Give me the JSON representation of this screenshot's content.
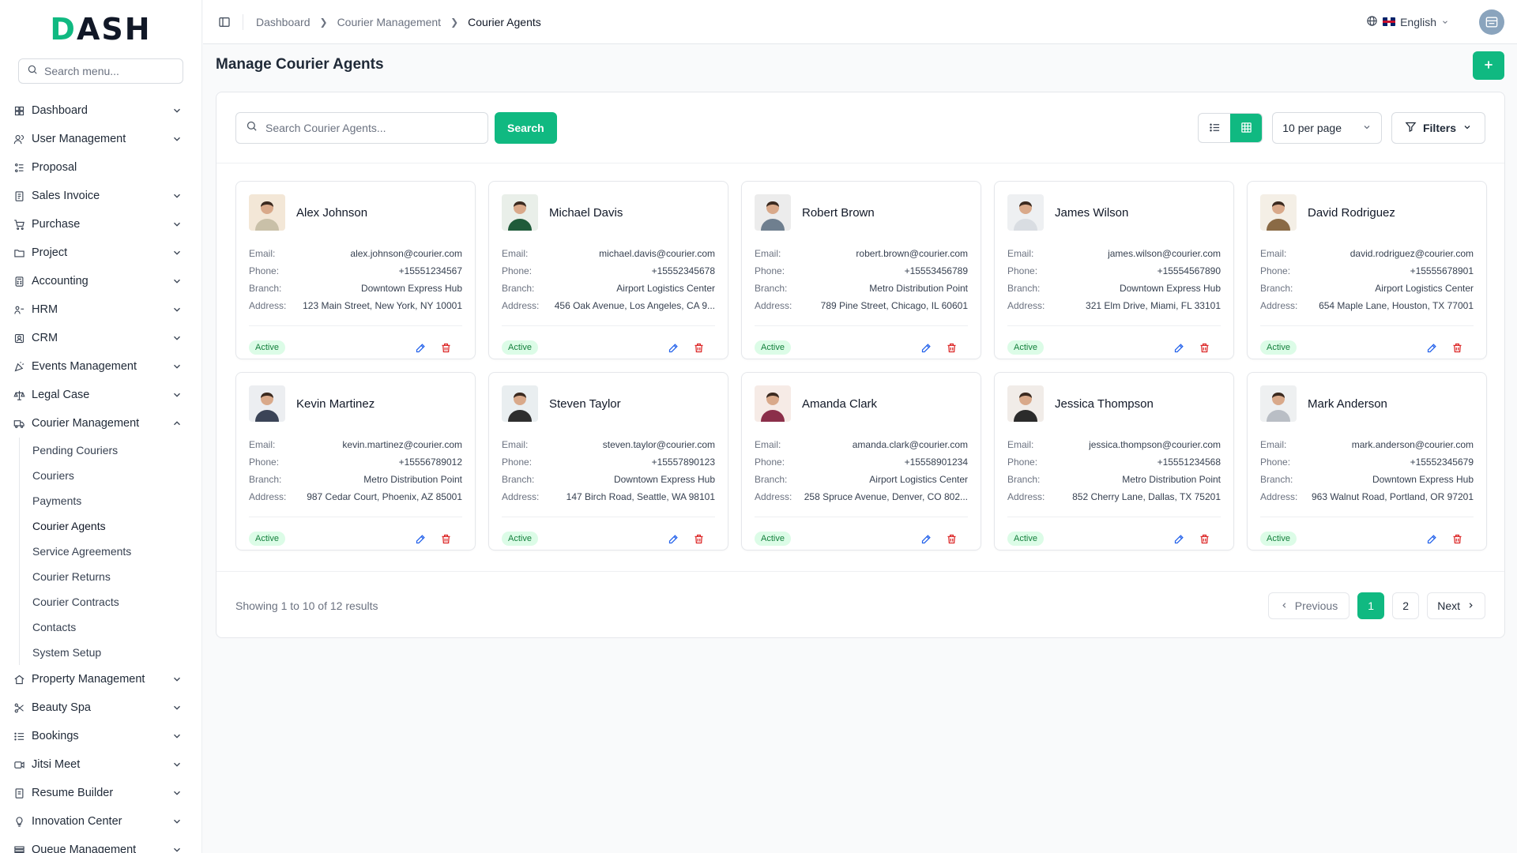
{
  "brand": {
    "logo_prefix": "D",
    "logo_rest": "ASH"
  },
  "sidebar": {
    "search_placeholder": "Search menu...",
    "items": [
      {
        "label": "Dashboard",
        "icon": "grid-icon",
        "chevron": "down"
      },
      {
        "label": "User Management",
        "icon": "users-icon",
        "chevron": "down"
      },
      {
        "label": "Proposal",
        "icon": "proposal-icon",
        "chevron": ""
      },
      {
        "label": "Sales Invoice",
        "icon": "invoice-icon",
        "chevron": "down"
      },
      {
        "label": "Purchase",
        "icon": "cart-icon",
        "chevron": "down"
      },
      {
        "label": "Project",
        "icon": "folder-icon",
        "chevron": "down"
      },
      {
        "label": "Accounting",
        "icon": "calculator-icon",
        "chevron": "down"
      },
      {
        "label": "HRM",
        "icon": "hrm-icon",
        "chevron": "down"
      },
      {
        "label": "CRM",
        "icon": "crm-icon",
        "chevron": "down"
      },
      {
        "label": "Events Management",
        "icon": "party-icon",
        "chevron": "down"
      },
      {
        "label": "Legal Case",
        "icon": "scale-icon",
        "chevron": "down"
      },
      {
        "label": "Courier Management",
        "icon": "truck-icon",
        "chevron": "up"
      }
    ],
    "sub_items": [
      "Pending Couriers",
      "Couriers",
      "Payments",
      "Courier Agents",
      "Service Agreements",
      "Courier Returns",
      "Courier Contracts",
      "Contacts",
      "System Setup"
    ],
    "items_after": [
      {
        "label": "Property Management",
        "icon": "property-icon"
      },
      {
        "label": "Beauty Spa",
        "icon": "scissors-icon"
      },
      {
        "label": "Bookings",
        "icon": "list-icon"
      },
      {
        "label": "Jitsi Meet",
        "icon": "video-icon"
      },
      {
        "label": "Resume Builder",
        "icon": "resume-icon"
      },
      {
        "label": "Innovation Center",
        "icon": "bulb-icon"
      },
      {
        "label": "Queue Management",
        "icon": "queue-icon"
      }
    ]
  },
  "topbar": {
    "breadcrumb": [
      "Dashboard",
      "Courier Management",
      "Courier Agents"
    ],
    "language": "English"
  },
  "page": {
    "title": "Manage Courier Agents",
    "search_placeholder": "Search Courier Agents...",
    "search_button": "Search",
    "per_page": "10 per page",
    "filters_label": "Filters"
  },
  "labels": {
    "email": "Email:",
    "phone": "Phone:",
    "branch": "Branch:",
    "address": "Address:"
  },
  "agents": [
    {
      "name": "Alex Johnson",
      "email": "alex.johnson@courier.com",
      "phone": "+15551234567",
      "branch": "Downtown Express Hub",
      "address": "123 Main Street, New York, NY 10001",
      "status": "Active"
    },
    {
      "name": "Michael Davis",
      "email": "michael.davis@courier.com",
      "phone": "+15552345678",
      "branch": "Airport Logistics Center",
      "address": "456 Oak Avenue, Los Angeles, CA 9...",
      "status": "Active"
    },
    {
      "name": "Robert Brown",
      "email": "robert.brown@courier.com",
      "phone": "+15553456789",
      "branch": "Metro Distribution Point",
      "address": "789 Pine Street, Chicago, IL 60601",
      "status": "Active"
    },
    {
      "name": "James Wilson",
      "email": "james.wilson@courier.com",
      "phone": "+15554567890",
      "branch": "Downtown Express Hub",
      "address": "321 Elm Drive, Miami, FL 33101",
      "status": "Active"
    },
    {
      "name": "David Rodriguez",
      "email": "david.rodriguez@courier.com",
      "phone": "+15555678901",
      "branch": "Airport Logistics Center",
      "address": "654 Maple Lane, Houston, TX 77001",
      "status": "Active"
    },
    {
      "name": "Kevin Martinez",
      "email": "kevin.martinez@courier.com",
      "phone": "+15556789012",
      "branch": "Metro Distribution Point",
      "address": "987 Cedar Court, Phoenix, AZ 85001",
      "status": "Active"
    },
    {
      "name": "Steven Taylor",
      "email": "steven.taylor@courier.com",
      "phone": "+15557890123",
      "branch": "Downtown Express Hub",
      "address": "147 Birch Road, Seattle, WA 98101",
      "status": "Active"
    },
    {
      "name": "Amanda Clark",
      "email": "amanda.clark@courier.com",
      "phone": "+15558901234",
      "branch": "Airport Logistics Center",
      "address": "258 Spruce Avenue, Denver, CO 802...",
      "status": "Active"
    },
    {
      "name": "Jessica Thompson",
      "email": "jessica.thompson@courier.com",
      "phone": "+15551234568",
      "branch": "Metro Distribution Point",
      "address": "852 Cherry Lane, Dallas, TX 75201",
      "status": "Active"
    },
    {
      "name": "Mark Anderson",
      "email": "mark.anderson@courier.com",
      "phone": "+15552345679",
      "branch": "Downtown Express Hub",
      "address": "963 Walnut Road, Portland, OR 97201",
      "status": "Active"
    }
  ],
  "pagination": {
    "showing": "Showing 1 to 10 of 12 results",
    "previous": "Previous",
    "next": "Next",
    "pages": [
      "1",
      "2"
    ],
    "current": "1"
  },
  "colors": {
    "accent": "#10b981",
    "danger": "#dc2626",
    "edit": "#2563eb",
    "badge_bg": "#dcfce7",
    "badge_text": "#15803d"
  }
}
